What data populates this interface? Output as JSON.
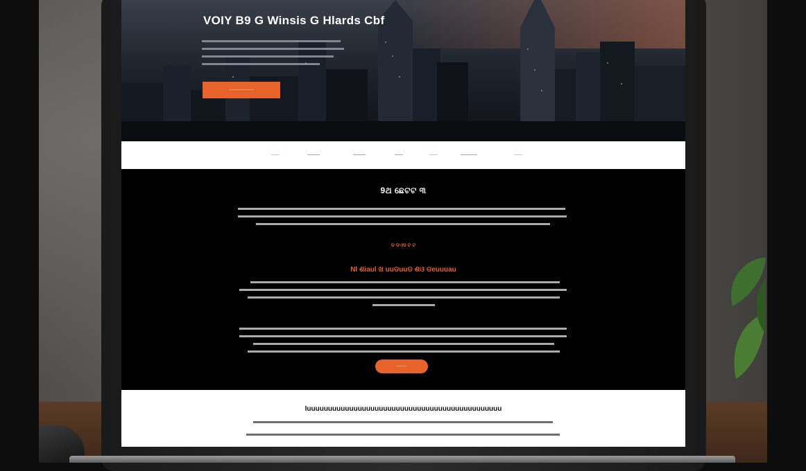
{
  "hero": {
    "title": "VOIY B9 G Winsis G Hlards Cbf",
    "cta_label": "——————"
  },
  "nav": {
    "items": [
      {
        "label": "——",
        "accent": true
      },
      {
        "label": "———",
        "accent": false
      },
      {
        "label": "———",
        "accent": false
      },
      {
        "label": "——",
        "accent": false
      },
      {
        "label": "——",
        "accent": true
      },
      {
        "label": "————",
        "accent": false
      },
      {
        "label": "——",
        "accent": true
      }
    ]
  },
  "content": {
    "section_title": "9ଥ ଛେଟଟ ୩",
    "sub_label": "ଡ ଡଏସ ଟ ଟ",
    "sub_title": "Nl ଶiaul ଖ uuଡuuଡ ଶଓ ଡeuuuau",
    "cta_label": "———"
  },
  "footer": {
    "heading": "Iuuuuuuuuuuuuuuuuuuuuuuuuuuuuuuuuuuuuuuuuuuuuuu"
  },
  "colors": {
    "accent": "#e8622c",
    "page_bg": "#000000",
    "nav_bg": "#ffffff",
    "footer_bg": "#ffffff"
  }
}
